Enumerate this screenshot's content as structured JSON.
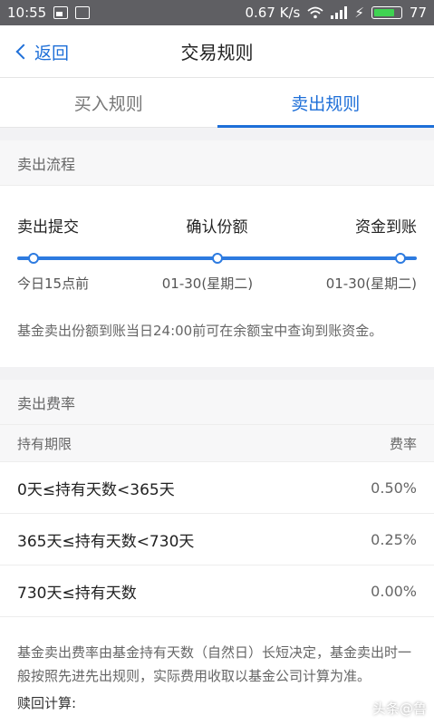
{
  "status": {
    "time": "10:55",
    "speed": "0.67 K/s",
    "network": "4G",
    "battery": "77"
  },
  "nav": {
    "back_label": "返回",
    "title": "交易规则"
  },
  "tabs": [
    {
      "label": "买入规则",
      "active": false
    },
    {
      "label": "卖出规则",
      "active": true
    }
  ],
  "flow": {
    "section_title": "卖出流程",
    "steps": [
      {
        "label": "卖出提交",
        "date": "今日15点前"
      },
      {
        "label": "确认份额",
        "date": "01-30(星期二)"
      },
      {
        "label": "资金到账",
        "date": "01-30(星期二)"
      }
    ],
    "note": "基金卖出份额到账当日24:00前可在余额宝中查询到账资金。"
  },
  "fee": {
    "section_title": "卖出费率",
    "columns": [
      "持有期限",
      "费率"
    ],
    "rows": [
      {
        "period": "0天≤持有天数<365天",
        "rate": "0.50%"
      },
      {
        "period": "365天≤持有天数<730天",
        "rate": "0.25%"
      },
      {
        "period": "730天≤持有天数",
        "rate": "0.00%"
      }
    ]
  },
  "footer": {
    "text": "基金卖出费率由基金持有天数（自然日）长短决定，基金卖出时一般按照先进先出规则，实际费用收取以基金公司计算为准。",
    "calc_label": "赎回计算:"
  },
  "watermark": "头条@鲁"
}
